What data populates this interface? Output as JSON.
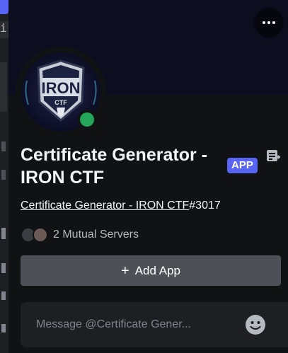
{
  "profile": {
    "display_name": "Certificate Generator - IRON CTF",
    "badge": "APP",
    "username_link": "Certificate Generator - IRON CTF",
    "discriminator": "#3017",
    "status": "online",
    "avatar_logo_text": "IRON",
    "avatar_sub_text": "CTF"
  },
  "mutual": {
    "label": "2 Mutual Servers"
  },
  "actions": {
    "add_app_icon": "+",
    "add_app_label": "Add App"
  },
  "message": {
    "placeholder": "Message @Certificate Gener..."
  },
  "background_fragment": {
    "text": "i"
  },
  "colors": {
    "accent": "#5865f2",
    "online": "#23a55a",
    "card_bg": "#111214",
    "banner": "#0c0e20",
    "button_bg": "#4e5058",
    "input_bg": "#1e1f22"
  },
  "icons": [
    "more-dots-icon",
    "note-icon",
    "emoji-icon",
    "plus-icon",
    "server-icon"
  ]
}
